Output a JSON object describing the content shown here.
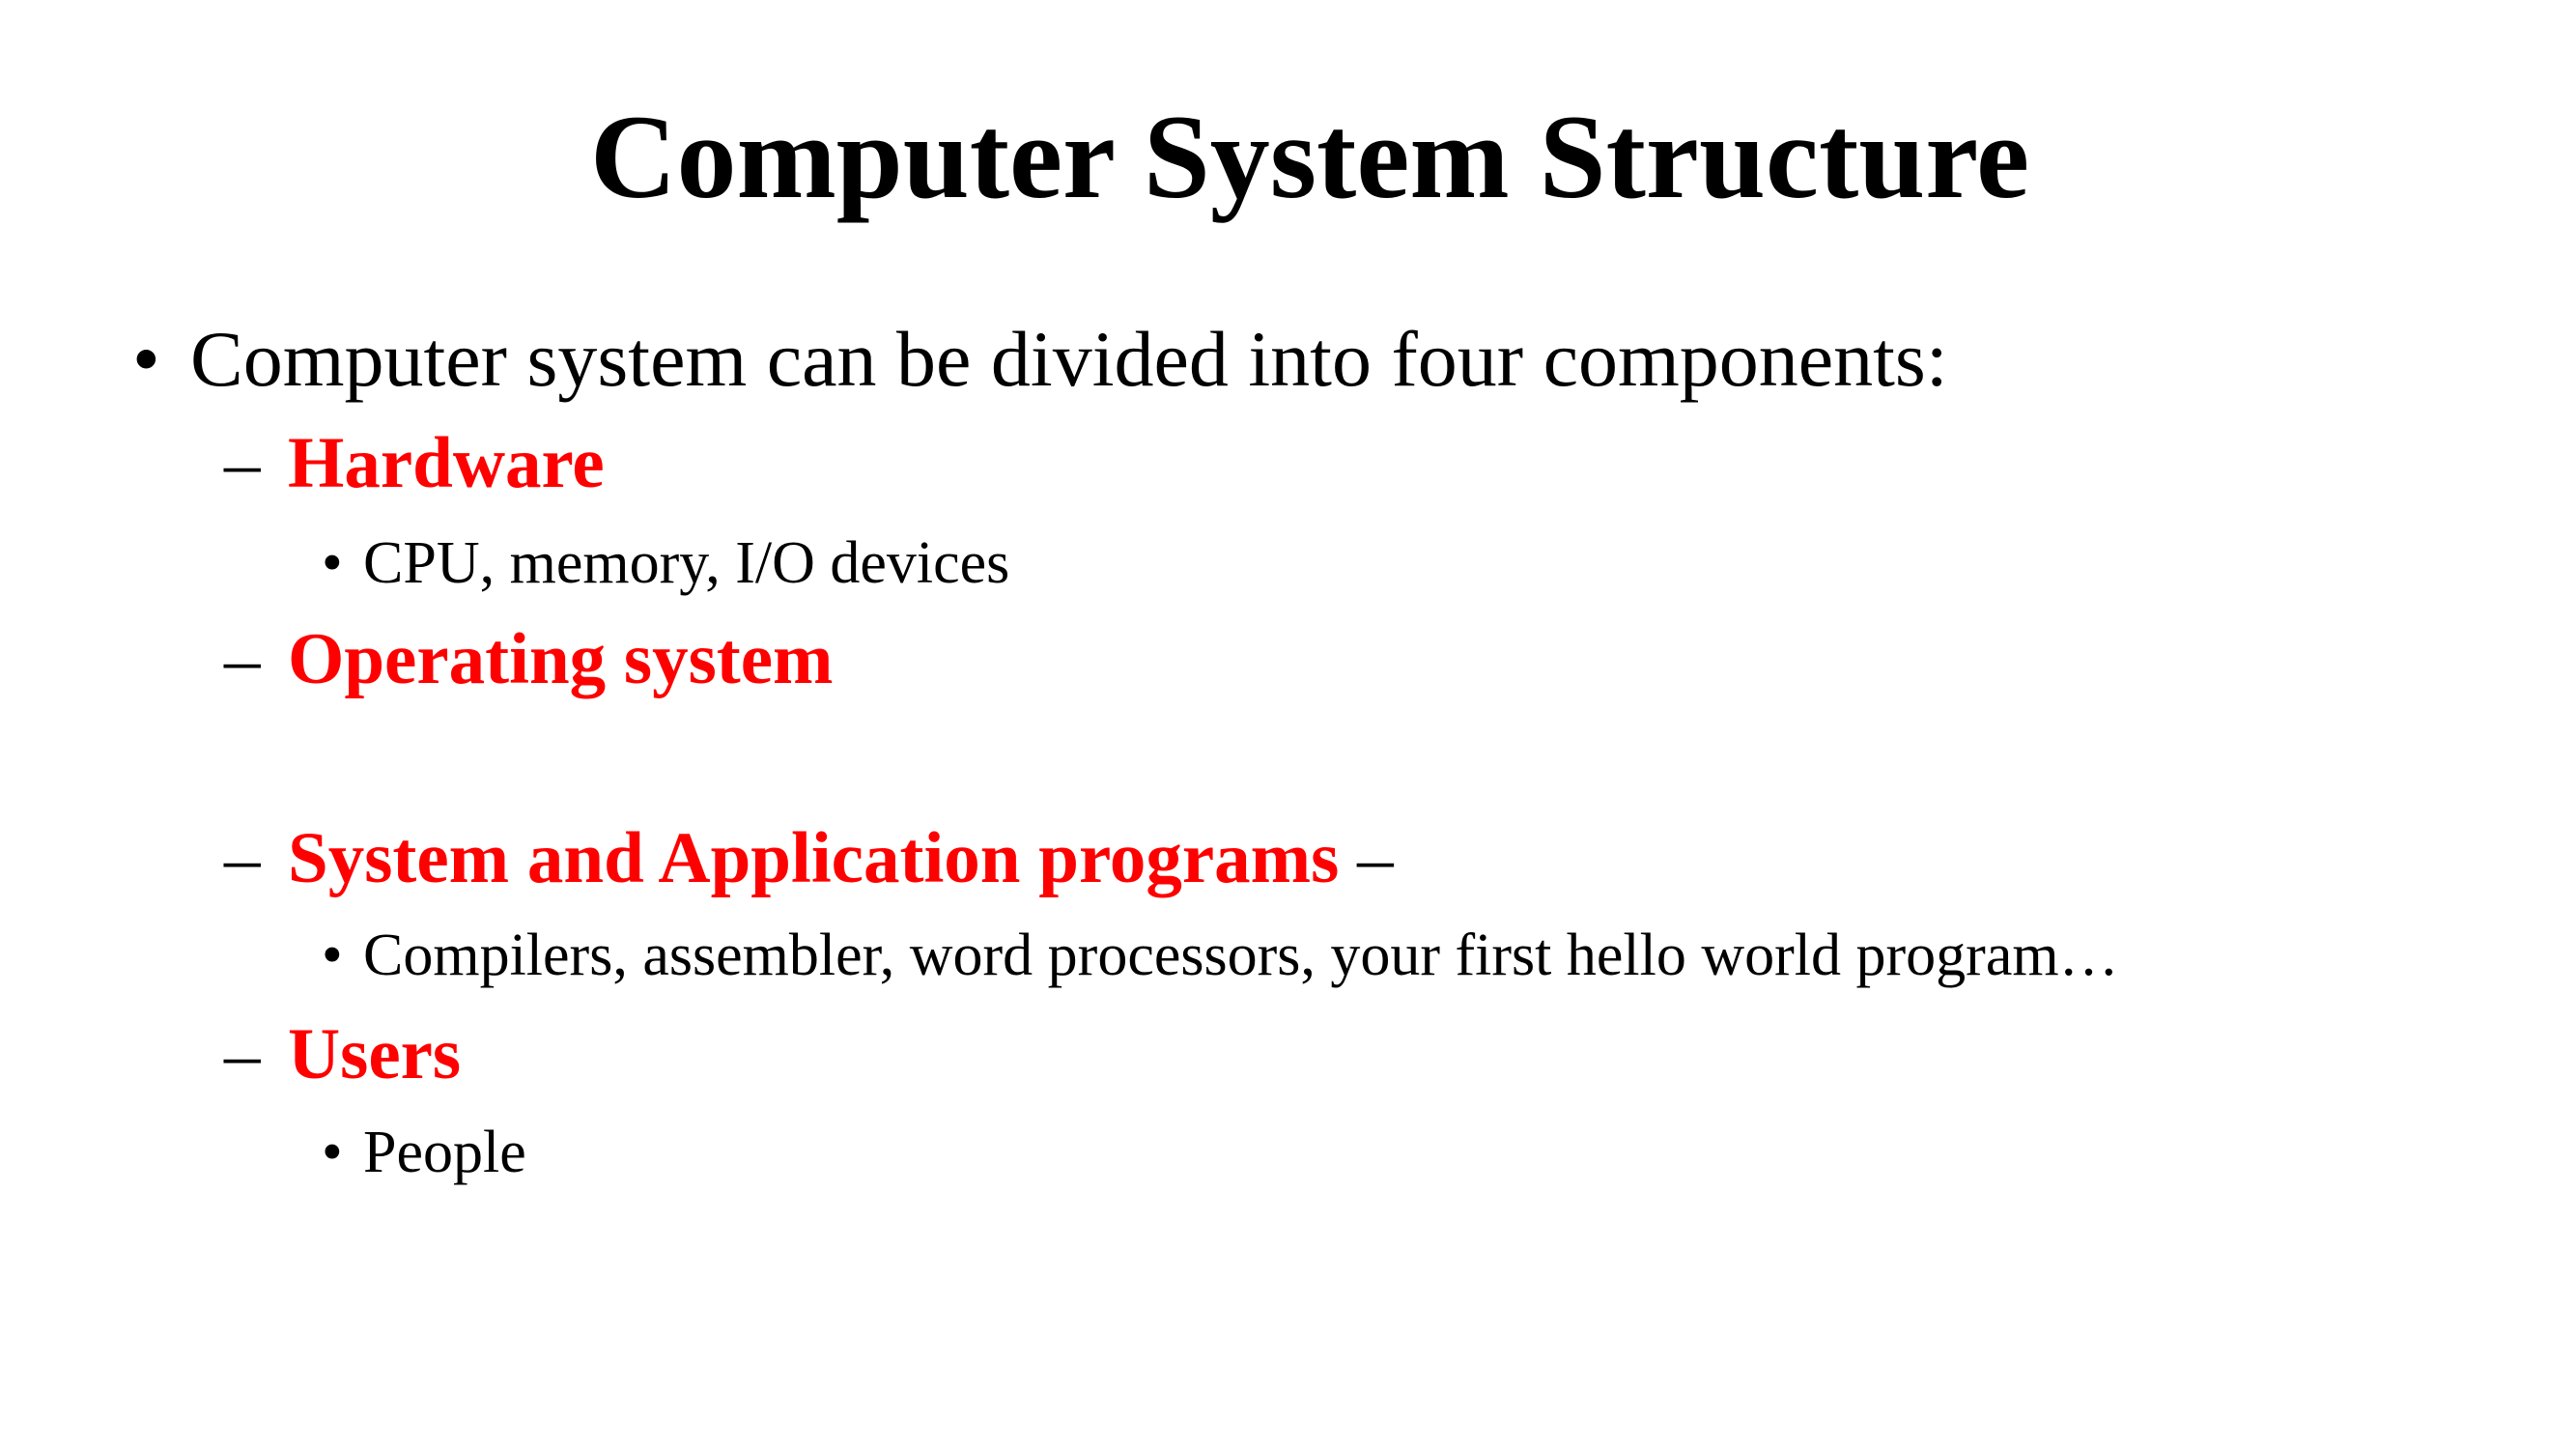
{
  "slide": {
    "title": "Computer System Structure",
    "intro": {
      "bullet": "•",
      "text": "Computer system can be divided into four components:"
    },
    "components": [
      {
        "dash": "–",
        "label": "Hardware",
        "suffix": "",
        "details": [
          "CPU, memory, I/O devices"
        ]
      },
      {
        "dash": "–",
        "label": "Operating system",
        "suffix": "",
        "details": []
      },
      {
        "dash": "–",
        "label": "System and Application programs",
        "suffix": " –",
        "details": [
          "Compilers, assembler, word processors, your first hello world program…"
        ]
      },
      {
        "dash": "–",
        "label": "Users",
        "suffix": "",
        "details": [
          "People"
        ]
      }
    ],
    "detail_bullet": "•"
  },
  "colors": {
    "background": "#ffffff",
    "text": "#000000",
    "highlight": "#ff0000"
  }
}
